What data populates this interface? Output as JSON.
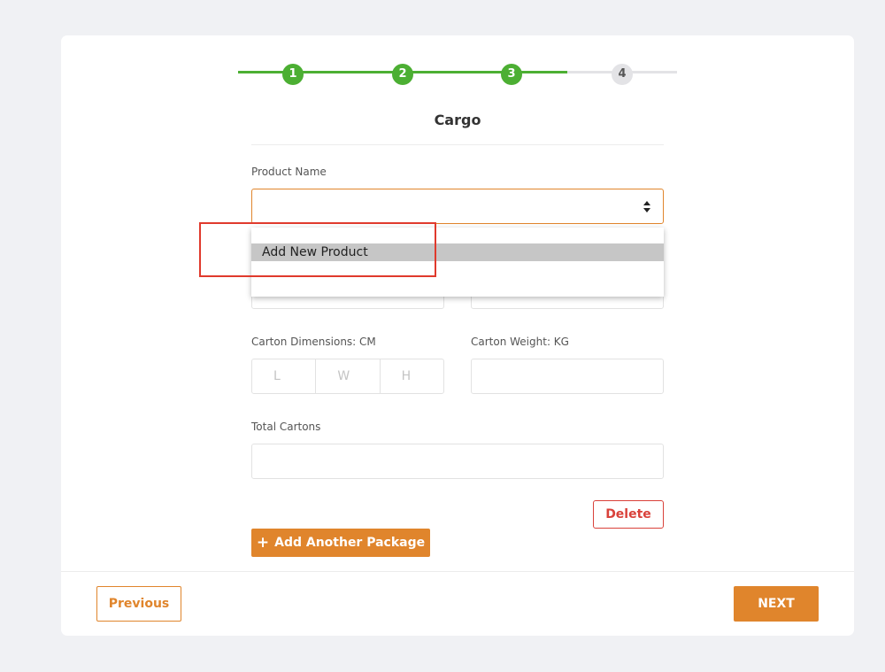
{
  "stepper": {
    "steps": [
      {
        "number": "1",
        "status": "complete"
      },
      {
        "number": "2",
        "status": "complete"
      },
      {
        "number": "3",
        "status": "current"
      },
      {
        "number": "4",
        "status": "upcoming"
      }
    ],
    "colors": {
      "complete": "#4caf33",
      "upcoming": "#e3e3e6"
    }
  },
  "section": {
    "title": "Cargo"
  },
  "product": {
    "label": "Product Name",
    "value": "",
    "dropdown_options": [
      "Add New Product"
    ]
  },
  "carton_dimensions": {
    "label": "Carton Dimensions: CM",
    "l_placeholder": "L",
    "w_placeholder": "W",
    "h_placeholder": "H"
  },
  "carton_weight": {
    "label": "Carton Weight: KG",
    "value": ""
  },
  "total_cartons": {
    "label": "Total Cartons",
    "value": ""
  },
  "actions": {
    "delete_label": "Delete",
    "add_package_label": "Add Another Package",
    "add_icon": "+",
    "previous_label": "Previous",
    "next_label": "NEXT"
  },
  "colors": {
    "accent": "#e0852c",
    "danger": "#d9413a",
    "success": "#4caf33",
    "annotation": "#e03a2d"
  }
}
